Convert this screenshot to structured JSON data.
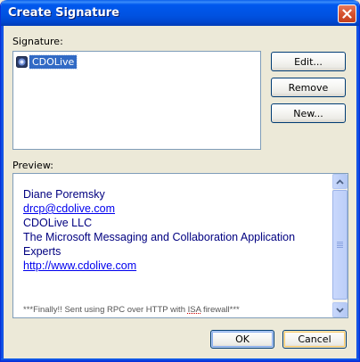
{
  "window": {
    "title": "Create Signature",
    "close_icon": "close-x-icon"
  },
  "signature": {
    "label": "Signature:",
    "items": [
      {
        "label": "CDOLive",
        "icon": "signature-icon",
        "selected": true
      }
    ]
  },
  "buttons": {
    "edit": "Edit...",
    "remove": "Remove",
    "new": "New...",
    "ok": "OK",
    "cancel": "Cancel"
  },
  "preview": {
    "label": "Preview:",
    "lines": {
      "name": "Diane Poremsky",
      "email": "drcp@cdolive.com",
      "company": "CDOLive LLC",
      "tagline_1": "The Microsoft Messaging and Collaboration Application",
      "tagline_2": "Experts",
      "url": "http://www.cdolive.com"
    },
    "footer_before": "***Finally!! Sent using RPC over HTTP with ",
    "footer_isa": "ISA",
    "footer_after": " firewall***"
  },
  "colors": {
    "title_bar": "#0054e3",
    "selection": "#316ac5",
    "preview_text": "#000080",
    "link": "#0000ee"
  }
}
